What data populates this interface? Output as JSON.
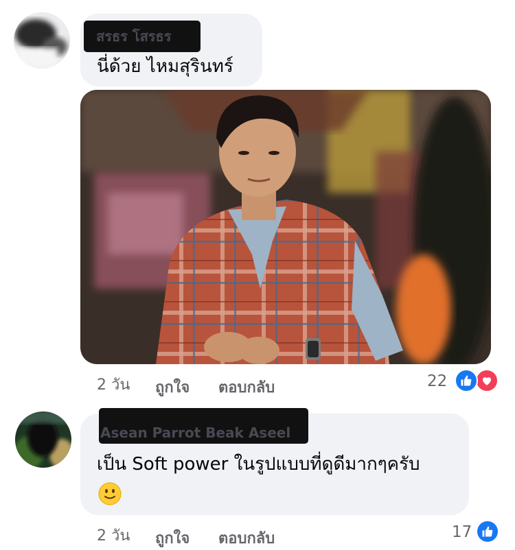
{
  "comments": [
    {
      "author": "สรธร โสรธร",
      "text": "นี่ด้วย ไหมสุรินทร์",
      "time": "2 วัน",
      "like_label": "ถูกใจ",
      "reply_label": "ตอบกลับ",
      "reaction_count": "22",
      "reactions": [
        "like-icon",
        "love-icon"
      ]
    },
    {
      "author": "Asean Parrot Beak Aseel",
      "text": "เป็น Soft power ในรูปแบบที่ดูดีมากๆครับ",
      "emoji": "🙂",
      "time": "2 วัน",
      "like_label": "ถูกใจ",
      "reply_label": "ตอบกลับ",
      "reaction_count": "17",
      "reactions": [
        "like-icon"
      ]
    }
  ],
  "colors": {
    "bubble": "#f0f2f5",
    "like_blue": "#1877f2",
    "love_red": "#f33e58",
    "meta_gray": "#65676b"
  }
}
